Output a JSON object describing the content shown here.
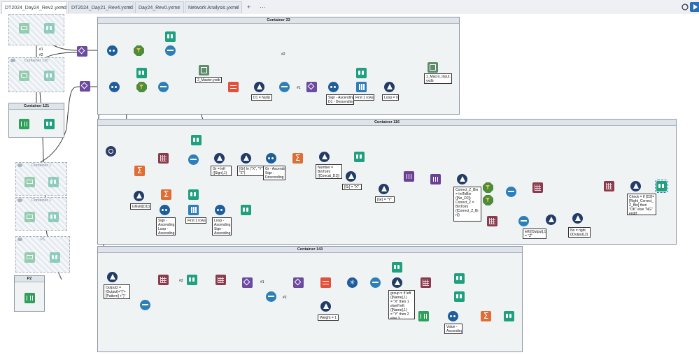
{
  "tabs": [
    {
      "label": "DT2024_Day24_Rev2.yxmd",
      "active": true
    },
    {
      "label": "DT2024_Day21_Rev4.yxmd",
      "active": false
    },
    {
      "label": "Day24_Rev0.yxmc",
      "active": false
    },
    {
      "label": "Network Analysis.yxmd",
      "active": false
    }
  ],
  "tab_close": "×",
  "new_tab": "+",
  "more_tabs": "···",
  "containers": {
    "c33": "Container 33",
    "c116": "Container 116",
    "c143": "Container 143",
    "c120": "Container 120",
    "c121": "Container 121",
    "c_a": "Container 1",
    "c_b": "Container 1",
    "p1": "P1",
    "p2": "P2"
  },
  "annotations": {
    "master": "2_Master.yxdb",
    "macro_input": "1_Macro_Input.\nyxdb",
    "d1null": "D1 = Null()",
    "sort_d1": "Sign - Ascending\nD1 - Descending",
    "first1_a": "First 1 rows",
    "loop0": "Loop = 0",
    "gr_left": "Gr = left\n([Sign],1)",
    "gr_in": "[Gr] In (\"X\", \"Y\",\n\"Z\")",
    "sort_gr": "Gr - Ascending\nSign -\nDescending",
    "number": "Number =\nBinToInt\n([Concat_D1])",
    "gr_x": "[Gr] = \"X\"",
    "gr_y": "[Gr] = \"Y\"",
    "correct": "Correct_Z_Bin\n= IntToBin\n([No_D2])\nCorrect_Z =\nBinToInt\n([Correct_Z_Bi\nn])",
    "check": "Check = If [D2]=\n[Right_Correct_\nZ_Bin] then\n\"OK\" else \"NG\"\nendif",
    "isnull": "IsNull([D1])",
    "sort_loop": "Sign -\nAscending\nLoop -\nAscending",
    "first1_b": "First 1 rows",
    "sort_loop2": "Loop -\nAscending\nSign -\nAscending",
    "left_output": "left([Output],1)\n= \"Z\"",
    "no_right": "No = right\n([Output],2)",
    "output2": "Output2 =\n[Output]+\"(\"+\n[Pattern] +\")\"",
    "group": "group = If left\n([Name],1)\n= \"X\" then 1\nelseif left\n([Name],1)\n= \"Y\" then 2\nelse 3",
    "weight": "Weight = 1",
    "value": "Value -\nAscending"
  },
  "anchors": {
    "a1": "#1",
    "a2": "#2"
  }
}
